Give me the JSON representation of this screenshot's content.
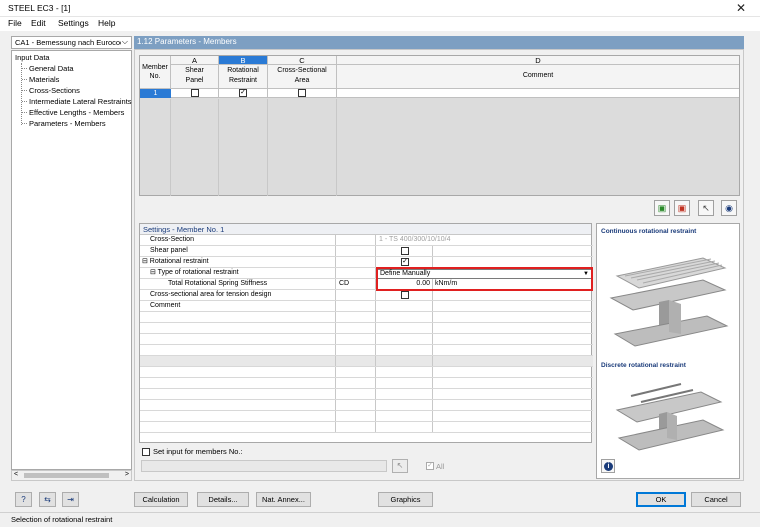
{
  "window": {
    "title": "STEEL EC3 - [1]",
    "close_glyph": "✕"
  },
  "menu": [
    "File",
    "Edit",
    "Settings",
    "Help"
  ],
  "case_selector": {
    "value": "CA1 - Bemessung nach Eurococ"
  },
  "tree": {
    "root": "Input Data",
    "items": [
      "General Data",
      "Materials",
      "Cross-Sections",
      "Intermediate Lateral Restraints",
      "Effective Lengths - Members",
      "Parameters - Members"
    ]
  },
  "section_title": "1.12 Parameters - Members",
  "grid": {
    "member_no_header": [
      "Member",
      "No."
    ],
    "columns": [
      {
        "letter": "A",
        "label": [
          "Shear",
          "Panel"
        ]
      },
      {
        "letter": "B",
        "label": [
          "Rotational",
          "Restraint"
        ]
      },
      {
        "letter": "C",
        "label": [
          "Cross-Sectional",
          "Area"
        ]
      },
      {
        "letter": "D",
        "label": [
          "Comment"
        ]
      }
    ],
    "rows": [
      {
        "member_no": "1",
        "shear_panel": false,
        "rotational_restraint": true,
        "cross_sectional_area": false,
        "comment": ""
      }
    ]
  },
  "toolbar_icons": [
    "export-excel-icon",
    "import-excel-icon",
    "select-in-graphics-icon",
    "view-icon"
  ],
  "settings": {
    "title": "Settings - Member No. 1",
    "rows": [
      {
        "label": "Cross-Section",
        "symbol": "",
        "value": "1 - TS 400/300/10/10/4",
        "unit": ""
      },
      {
        "label": "Shear panel",
        "symbol": "",
        "value": "",
        "unit": "",
        "checkbox": false
      },
      {
        "label": "⊟ Rotational restraint",
        "symbol": "",
        "value": "",
        "unit": "",
        "checkbox": true
      },
      {
        "label": "⊟ Type of rotational restraint",
        "symbol": "",
        "value": "Define Manually",
        "unit": ""
      },
      {
        "label": "Total Rotational Spring Stiffness",
        "symbol": "CD",
        "value": "0.00",
        "unit": "kNm/m"
      },
      {
        "label": "Cross-sectional area for tension design",
        "symbol": "",
        "value": "",
        "unit": "",
        "checkbox": false
      },
      {
        "label": "Comment",
        "symbol": "",
        "value": "",
        "unit": ""
      }
    ]
  },
  "set_input": {
    "label": "Set input for members No.:",
    "all_label": "All"
  },
  "right_panel": {
    "caption_top": "Continuous rotational restraint",
    "caption_bottom": "Discrete rotational restraint"
  },
  "buttons": {
    "calculation": "Calculation",
    "details": "Details...",
    "nat_annex": "Nat. Annex...",
    "graphics": "Graphics",
    "ok": "OK",
    "cancel": "Cancel"
  },
  "status": "Selection of rotational restraint",
  "colors": {
    "header_bar": "#7d9fc2",
    "selection": "#2a7ad5",
    "highlight": "#e02020"
  }
}
